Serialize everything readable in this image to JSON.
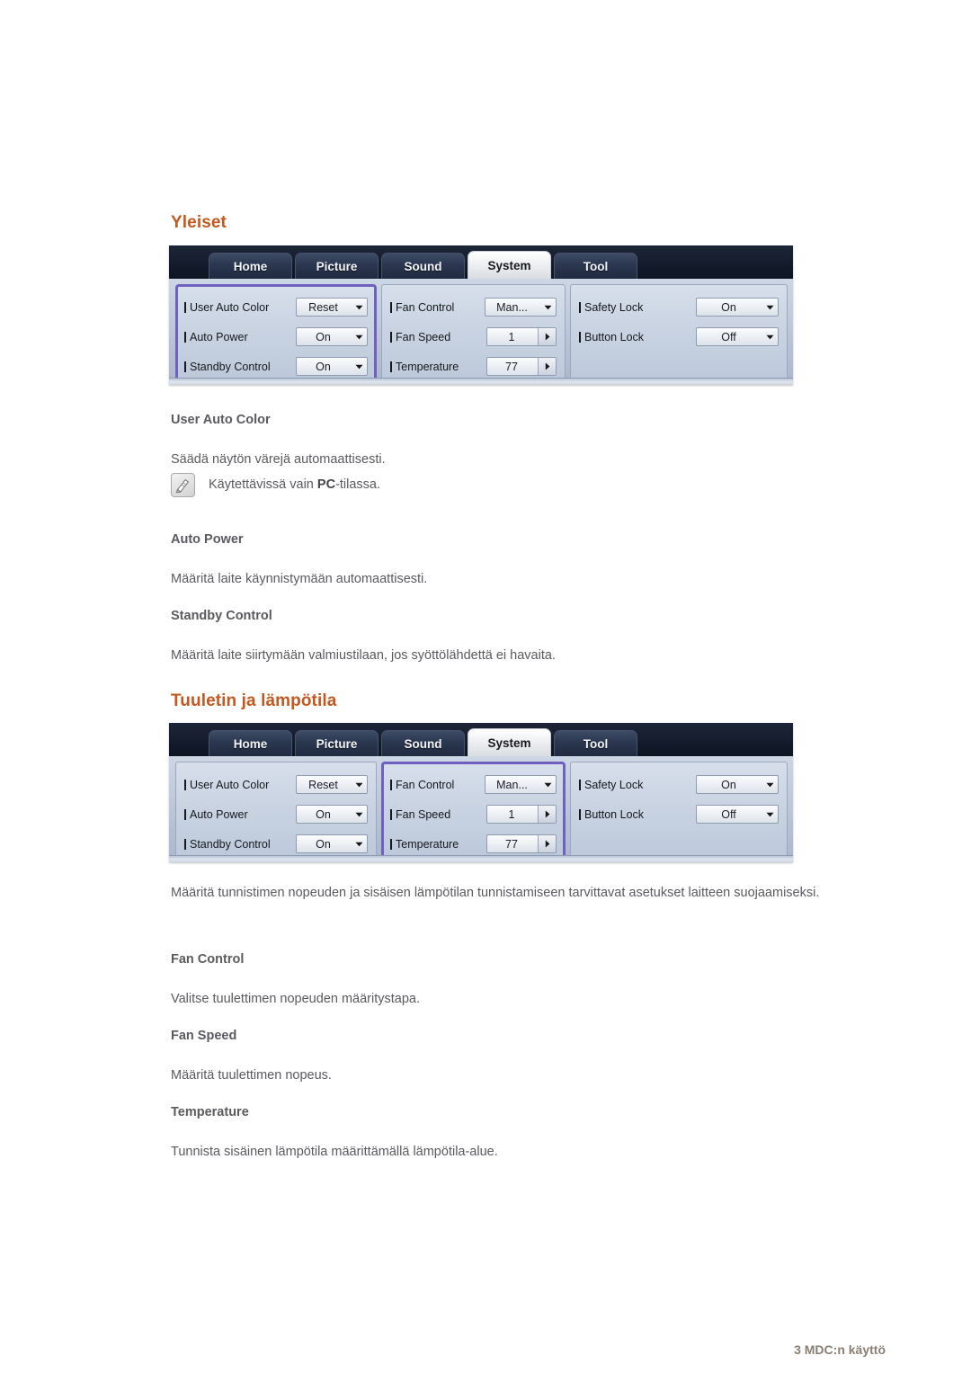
{
  "document": {
    "footer_label": "3 MDC:n käyttö"
  },
  "sections": [
    {
      "heading": "Yleiset",
      "items": [
        {
          "title": "User Auto Color",
          "body": "Säädä näytön värejä automaattisesti."
        },
        {
          "title": "Auto Power",
          "body": "Määritä laite käynnistymään automaattisesti."
        },
        {
          "title": "Standby Control",
          "body": "Määritä laite siirtymään valmiustilaan, jos syöttölähdettä ei havaita."
        }
      ],
      "note": {
        "icon": "note-pencil-icon",
        "text_before": "Käytettävissä vain ",
        "text_strong": "PC",
        "text_after": "-tilassa."
      }
    },
    {
      "heading": "Tuuletin ja lämpötila",
      "intro": "Määritä tunnistimen nopeuden ja sisäisen lämpötilan tunnistamiseen tarvittavat asetukset laitteen suojaamiseksi.",
      "items": [
        {
          "title": "Fan Control",
          "body": "Valitse tuulettimen nopeuden määritystapa."
        },
        {
          "title": "Fan Speed",
          "body": "Määritä tuulettimen nopeus."
        },
        {
          "title": "Temperature",
          "body": "Tunnista sisäinen lämpötila määrittämällä lämpötila-alue."
        }
      ]
    }
  ],
  "mdc": {
    "tabs": [
      {
        "label": "Home",
        "active": false
      },
      {
        "label": "Picture",
        "active": false
      },
      {
        "label": "Sound",
        "active": false
      },
      {
        "label": "System",
        "active": true
      },
      {
        "label": "Tool",
        "active": false
      }
    ],
    "groups": {
      "general": {
        "rows": [
          {
            "label": "User Auto Color",
            "value": "Reset",
            "control": "dropdown"
          },
          {
            "label": "Auto Power",
            "value": "On",
            "control": "dropdown"
          },
          {
            "label": "Standby Control",
            "value": "On",
            "control": "dropdown"
          }
        ]
      },
      "fan": {
        "rows": [
          {
            "label": "Fan Control",
            "value": "Man...",
            "control": "dropdown"
          },
          {
            "label": "Fan Speed",
            "value": "1",
            "control": "spinner"
          },
          {
            "label": "Temperature",
            "value": "77",
            "control": "spinner"
          }
        ]
      },
      "lock": {
        "rows": [
          {
            "label": "Safety Lock",
            "value": "On",
            "control": "dropdown"
          },
          {
            "label": "Button Lock",
            "value": "Off",
            "control": "dropdown"
          }
        ]
      }
    },
    "highlight_colors": {
      "purple": "#7060c0",
      "tabbar": "#141c2d",
      "panel": "#c2cddd"
    }
  },
  "screenshot_one": {
    "highlighted_group": "general"
  },
  "screenshot_two": {
    "highlighted_group": "fan"
  }
}
